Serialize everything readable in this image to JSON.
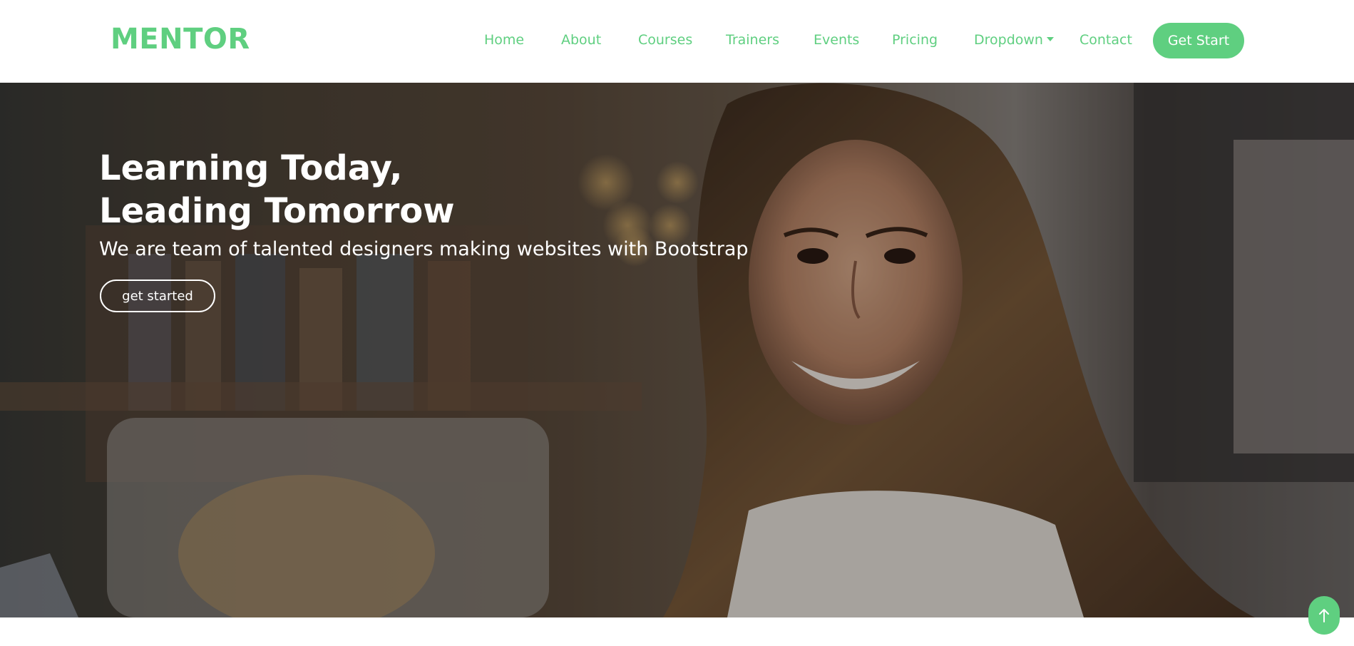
{
  "brand": {
    "logo_text": "MENTOR",
    "accent_color": "#5fcf80"
  },
  "nav": {
    "items": [
      {
        "label": "Home"
      },
      {
        "label": "About"
      },
      {
        "label": "Courses"
      },
      {
        "label": "Trainers"
      },
      {
        "label": "Events"
      },
      {
        "label": "Pricing"
      },
      {
        "label": "Dropdown",
        "icon": "chevron-down-icon"
      },
      {
        "label": "Contact"
      }
    ],
    "cta_label": "Get Start"
  },
  "hero": {
    "title_line1": "Learning Today,",
    "title_line2": "Leading Tomorrow",
    "subtitle": "We are team of talented designers making websites with Bootstrap",
    "button_label": "get started",
    "background_image": "smiling-woman-photo"
  },
  "scroll_top": {
    "icon": "arrow-up-icon"
  }
}
